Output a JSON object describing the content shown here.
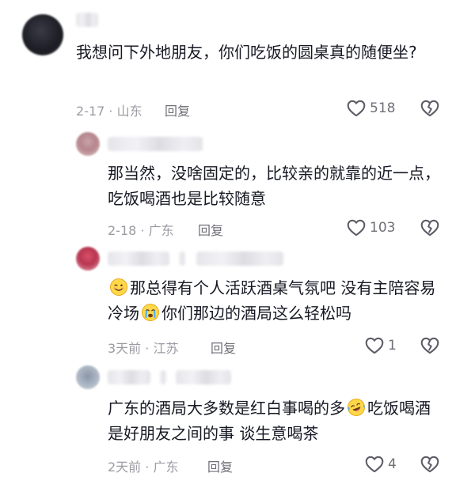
{
  "comments": [
    {
      "text": "我想问下外地朋友，你们吃饭的圆桌真的随便坐?",
      "meta": "2-17 · 山东",
      "reply_label": "回复",
      "likes": "518"
    },
    {
      "text": "那当然，没啥固定的，比较亲的就靠的近一点，吃饭喝酒也是比较随意",
      "meta": "2-18 · 广东",
      "reply_label": "回复",
      "likes": "103"
    },
    {
      "text_a": "那总得有个人活跃酒桌气氛吧 没有主陪容易冷场",
      "text_b": "你们那边的酒局这么轻松吗",
      "meta": "3天前 · 江苏",
      "reply_label": "回复",
      "likes": "1"
    },
    {
      "text_a": "广东的酒局大多数是红白事喝的多",
      "text_b": "吃饭喝酒是好朋友之间的事 谈生意喝茶",
      "meta": "2天前 · 广东",
      "reply_label": "回复",
      "likes": "4"
    }
  ],
  "icons": {
    "like": "heart-outline-icon",
    "dislike": "broken-heart-outline-icon",
    "emoji_1": "wink-smile-emoji-icon",
    "emoji_2": "crying-emoji-icon",
    "emoji_3": "laughing-tears-emoji-icon"
  },
  "colors": {
    "text": "#161823",
    "meta": "#9b9ba3",
    "icon": "#5c5c66"
  }
}
